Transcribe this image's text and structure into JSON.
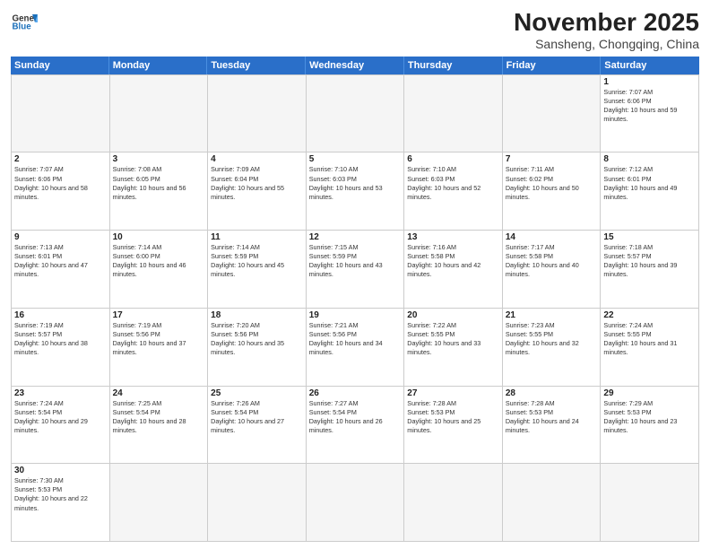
{
  "header": {
    "logo_line1": "General",
    "logo_line2": "Blue",
    "month_title": "November 2025",
    "location": "Sansheng, Chongqing, China"
  },
  "weekdays": [
    "Sunday",
    "Monday",
    "Tuesday",
    "Wednesday",
    "Thursday",
    "Friday",
    "Saturday"
  ],
  "days": [
    {
      "num": "",
      "sunrise": "",
      "sunset": "",
      "daylight": "",
      "empty": true
    },
    {
      "num": "",
      "sunrise": "",
      "sunset": "",
      "daylight": "",
      "empty": true
    },
    {
      "num": "",
      "sunrise": "",
      "sunset": "",
      "daylight": "",
      "empty": true
    },
    {
      "num": "",
      "sunrise": "",
      "sunset": "",
      "daylight": "",
      "empty": true
    },
    {
      "num": "",
      "sunrise": "",
      "sunset": "",
      "daylight": "",
      "empty": true
    },
    {
      "num": "",
      "sunrise": "",
      "sunset": "",
      "daylight": "",
      "empty": true
    },
    {
      "num": "1",
      "sunrise": "Sunrise: 7:07 AM",
      "sunset": "Sunset: 6:06 PM",
      "daylight": "Daylight: 10 hours and 59 minutes.",
      "empty": false
    },
    {
      "num": "2",
      "sunrise": "Sunrise: 7:07 AM",
      "sunset": "Sunset: 6:06 PM",
      "daylight": "Daylight: 10 hours and 58 minutes.",
      "empty": false
    },
    {
      "num": "3",
      "sunrise": "Sunrise: 7:08 AM",
      "sunset": "Sunset: 6:05 PM",
      "daylight": "Daylight: 10 hours and 56 minutes.",
      "empty": false
    },
    {
      "num": "4",
      "sunrise": "Sunrise: 7:09 AM",
      "sunset": "Sunset: 6:04 PM",
      "daylight": "Daylight: 10 hours and 55 minutes.",
      "empty": false
    },
    {
      "num": "5",
      "sunrise": "Sunrise: 7:10 AM",
      "sunset": "Sunset: 6:03 PM",
      "daylight": "Daylight: 10 hours and 53 minutes.",
      "empty": false
    },
    {
      "num": "6",
      "sunrise": "Sunrise: 7:10 AM",
      "sunset": "Sunset: 6:03 PM",
      "daylight": "Daylight: 10 hours and 52 minutes.",
      "empty": false
    },
    {
      "num": "7",
      "sunrise": "Sunrise: 7:11 AM",
      "sunset": "Sunset: 6:02 PM",
      "daylight": "Daylight: 10 hours and 50 minutes.",
      "empty": false
    },
    {
      "num": "8",
      "sunrise": "Sunrise: 7:12 AM",
      "sunset": "Sunset: 6:01 PM",
      "daylight": "Daylight: 10 hours and 49 minutes.",
      "empty": false
    },
    {
      "num": "9",
      "sunrise": "Sunrise: 7:13 AM",
      "sunset": "Sunset: 6:01 PM",
      "daylight": "Daylight: 10 hours and 47 minutes.",
      "empty": false
    },
    {
      "num": "10",
      "sunrise": "Sunrise: 7:14 AM",
      "sunset": "Sunset: 6:00 PM",
      "daylight": "Daylight: 10 hours and 46 minutes.",
      "empty": false
    },
    {
      "num": "11",
      "sunrise": "Sunrise: 7:14 AM",
      "sunset": "Sunset: 5:59 PM",
      "daylight": "Daylight: 10 hours and 45 minutes.",
      "empty": false
    },
    {
      "num": "12",
      "sunrise": "Sunrise: 7:15 AM",
      "sunset": "Sunset: 5:59 PM",
      "daylight": "Daylight: 10 hours and 43 minutes.",
      "empty": false
    },
    {
      "num": "13",
      "sunrise": "Sunrise: 7:16 AM",
      "sunset": "Sunset: 5:58 PM",
      "daylight": "Daylight: 10 hours and 42 minutes.",
      "empty": false
    },
    {
      "num": "14",
      "sunrise": "Sunrise: 7:17 AM",
      "sunset": "Sunset: 5:58 PM",
      "daylight": "Daylight: 10 hours and 40 minutes.",
      "empty": false
    },
    {
      "num": "15",
      "sunrise": "Sunrise: 7:18 AM",
      "sunset": "Sunset: 5:57 PM",
      "daylight": "Daylight: 10 hours and 39 minutes.",
      "empty": false
    },
    {
      "num": "16",
      "sunrise": "Sunrise: 7:19 AM",
      "sunset": "Sunset: 5:57 PM",
      "daylight": "Daylight: 10 hours and 38 minutes.",
      "empty": false
    },
    {
      "num": "17",
      "sunrise": "Sunrise: 7:19 AM",
      "sunset": "Sunset: 5:56 PM",
      "daylight": "Daylight: 10 hours and 37 minutes.",
      "empty": false
    },
    {
      "num": "18",
      "sunrise": "Sunrise: 7:20 AM",
      "sunset": "Sunset: 5:56 PM",
      "daylight": "Daylight: 10 hours and 35 minutes.",
      "empty": false
    },
    {
      "num": "19",
      "sunrise": "Sunrise: 7:21 AM",
      "sunset": "Sunset: 5:56 PM",
      "daylight": "Daylight: 10 hours and 34 minutes.",
      "empty": false
    },
    {
      "num": "20",
      "sunrise": "Sunrise: 7:22 AM",
      "sunset": "Sunset: 5:55 PM",
      "daylight": "Daylight: 10 hours and 33 minutes.",
      "empty": false
    },
    {
      "num": "21",
      "sunrise": "Sunrise: 7:23 AM",
      "sunset": "Sunset: 5:55 PM",
      "daylight": "Daylight: 10 hours and 32 minutes.",
      "empty": false
    },
    {
      "num": "22",
      "sunrise": "Sunrise: 7:24 AM",
      "sunset": "Sunset: 5:55 PM",
      "daylight": "Daylight: 10 hours and 31 minutes.",
      "empty": false
    },
    {
      "num": "23",
      "sunrise": "Sunrise: 7:24 AM",
      "sunset": "Sunset: 5:54 PM",
      "daylight": "Daylight: 10 hours and 29 minutes.",
      "empty": false
    },
    {
      "num": "24",
      "sunrise": "Sunrise: 7:25 AM",
      "sunset": "Sunset: 5:54 PM",
      "daylight": "Daylight: 10 hours and 28 minutes.",
      "empty": false
    },
    {
      "num": "25",
      "sunrise": "Sunrise: 7:26 AM",
      "sunset": "Sunset: 5:54 PM",
      "daylight": "Daylight: 10 hours and 27 minutes.",
      "empty": false
    },
    {
      "num": "26",
      "sunrise": "Sunrise: 7:27 AM",
      "sunset": "Sunset: 5:54 PM",
      "daylight": "Daylight: 10 hours and 26 minutes.",
      "empty": false
    },
    {
      "num": "27",
      "sunrise": "Sunrise: 7:28 AM",
      "sunset": "Sunset: 5:53 PM",
      "daylight": "Daylight: 10 hours and 25 minutes.",
      "empty": false
    },
    {
      "num": "28",
      "sunrise": "Sunrise: 7:28 AM",
      "sunset": "Sunset: 5:53 PM",
      "daylight": "Daylight: 10 hours and 24 minutes.",
      "empty": false
    },
    {
      "num": "29",
      "sunrise": "Sunrise: 7:29 AM",
      "sunset": "Sunset: 5:53 PM",
      "daylight": "Daylight: 10 hours and 23 minutes.",
      "empty": false
    },
    {
      "num": "30",
      "sunrise": "Sunrise: 7:30 AM",
      "sunset": "Sunset: 5:53 PM",
      "daylight": "Daylight: 10 hours and 22 minutes.",
      "empty": false
    },
    {
      "num": "",
      "sunrise": "",
      "sunset": "",
      "daylight": "",
      "empty": true
    },
    {
      "num": "",
      "sunrise": "",
      "sunset": "",
      "daylight": "",
      "empty": true
    },
    {
      "num": "",
      "sunrise": "",
      "sunset": "",
      "daylight": "",
      "empty": true
    },
    {
      "num": "",
      "sunrise": "",
      "sunset": "",
      "daylight": "",
      "empty": true
    },
    {
      "num": "",
      "sunrise": "",
      "sunset": "",
      "daylight": "",
      "empty": true
    },
    {
      "num": "",
      "sunrise": "",
      "sunset": "",
      "daylight": "",
      "empty": true
    }
  ]
}
